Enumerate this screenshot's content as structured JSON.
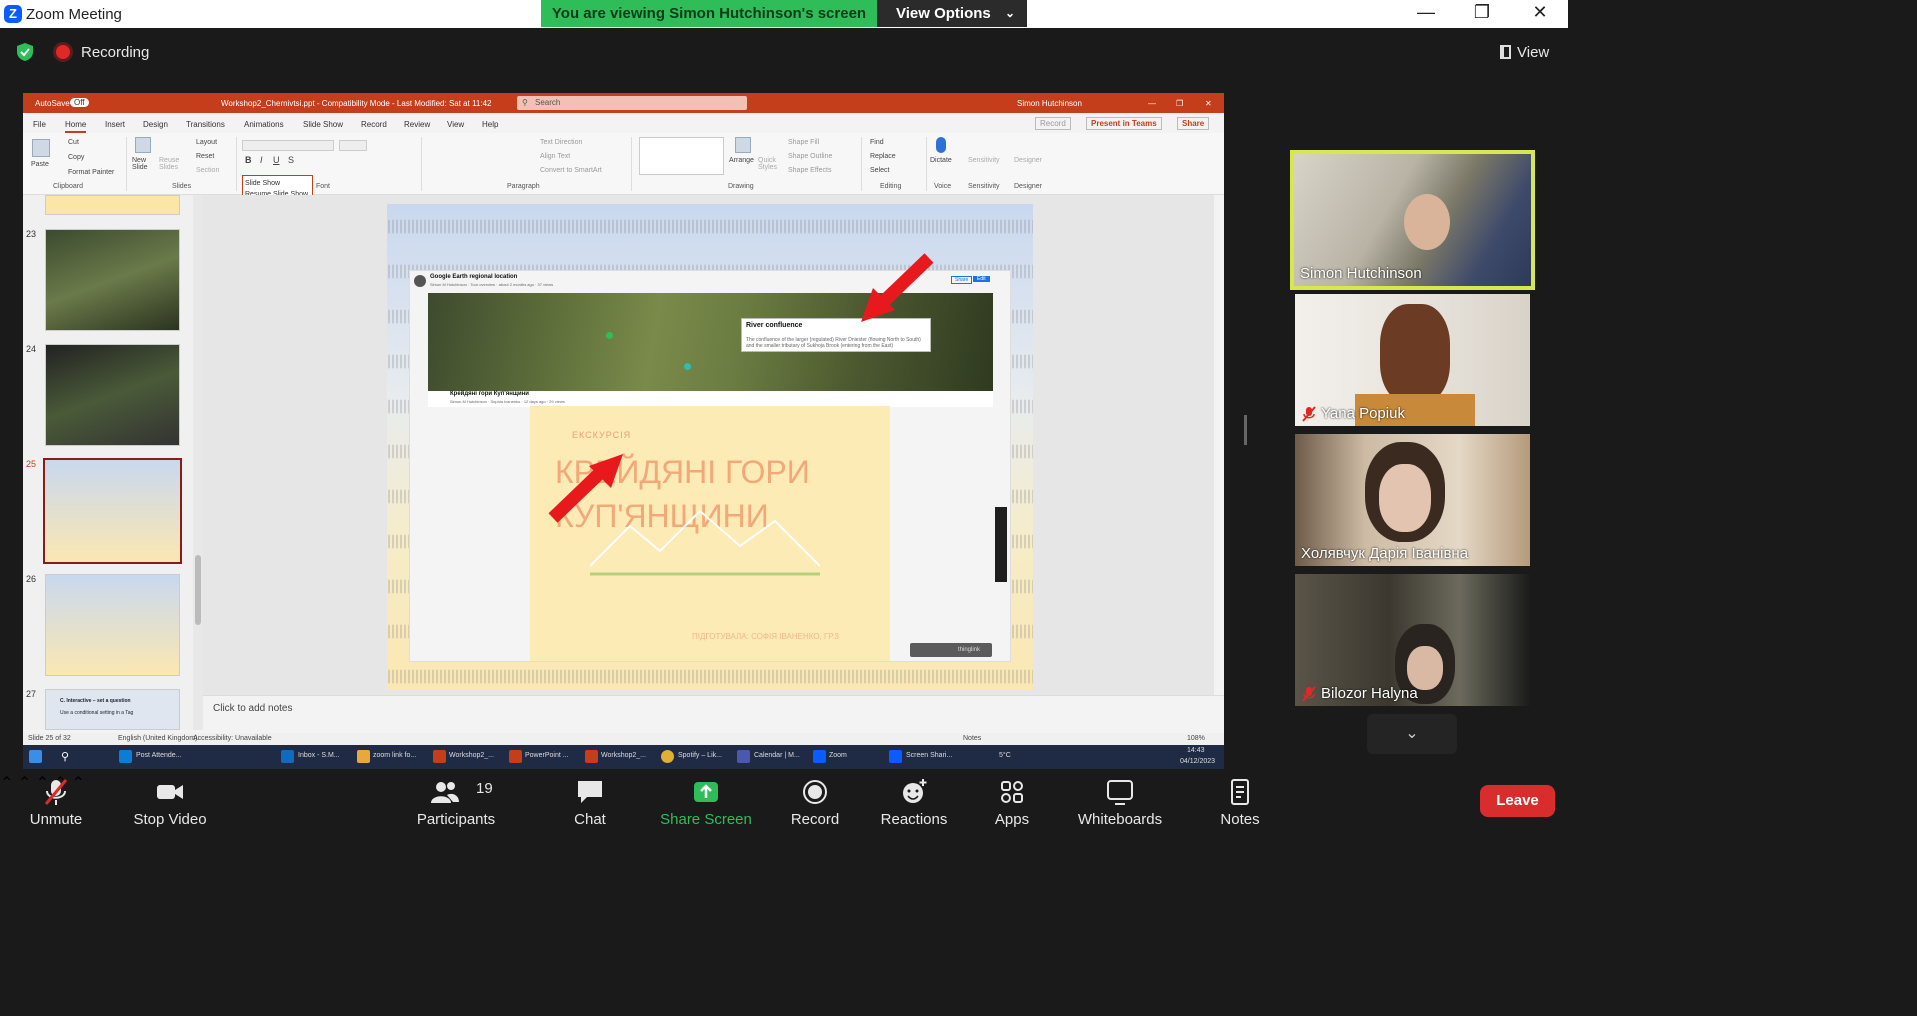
{
  "window": {
    "app_title": "Zoom Meeting",
    "viewing_banner": "You are viewing Simon Hutchinson's screen",
    "view_options_label": "View Options"
  },
  "topbar": {
    "recording_label": "Recording",
    "view_label": "View"
  },
  "powerpoint": {
    "autosave": "AutoSave",
    "autosave_state": "Off",
    "file_title": "Workshop2_Chernivtsi.ppt  -  Compatibility Mode  -  Last Modified: Sat at 11:42",
    "search_placeholder": "Search",
    "user_name": "Simon Hutchinson",
    "tabs": [
      "File",
      "Home",
      "Insert",
      "Design",
      "Transitions",
      "Animations",
      "Slide Show",
      "Record",
      "Review",
      "View",
      "Help"
    ],
    "right_buttons": {
      "record": "Record",
      "present_teams": "Present in Teams",
      "share": "Share"
    },
    "ribbon": {
      "clipboard": {
        "paste": "Paste",
        "cut": "Cut",
        "copy": "Copy",
        "format_painter": "Format Painter",
        "group": "Clipboard"
      },
      "slides": {
        "new_slide": "New Slide",
        "reuse": "Reuse Slides",
        "layout": "Layout",
        "reset": "Reset",
        "section": "Section",
        "group": "Slides"
      },
      "font_group": "Font",
      "paragraph": {
        "text_direction": "Text Direction",
        "align_text": "Align Text",
        "convert_smartart": "Convert to SmartArt",
        "group": "Paragraph"
      },
      "drawing": {
        "arrange": "Arrange",
        "quick_styles": "Quick Styles",
        "shape_fill": "Shape Fill",
        "shape_outline": "Shape Outline",
        "shape_effects": "Shape Effects",
        "group": "Drawing"
      },
      "editing": {
        "find": "Find",
        "replace": "Replace",
        "select": "Select",
        "group": "Editing"
      },
      "voice": {
        "dictate": "Dictate",
        "group": "Voice"
      },
      "sensitivity": {
        "label": "Sensitivity",
        "group": "Sensitivity"
      },
      "designer": {
        "label": "Designer",
        "group": "Designer"
      }
    },
    "slideshow_menu": [
      "Slide Show",
      "Resume Slide Show"
    ],
    "thumbnails": [
      {
        "num": "23",
        "selected": false
      },
      {
        "num": "24",
        "selected": false
      },
      {
        "num": "25",
        "selected": true
      },
      {
        "num": "26",
        "selected": false
      },
      {
        "num": "27",
        "selected": false,
        "caption": "C. Interactive – set a question",
        "sub": "Use a conditional setting in a Tag"
      }
    ],
    "slide": {
      "browser_title": "Google Earth regional location",
      "browser_author": "Simon M Hutchinson",
      "browser_meta": "Tour overview · about 2 months ago · 37 views",
      "share_label": "Share",
      "edit_label": "Edit",
      "info_title": "River confluence",
      "info_body": "The confluence of the larger (regulated) River Dniester (flowing North to South) and the smaller tributary of Sukhoja Brook (entering from the East)",
      "second_title": "Крейдяні гори Куп'янщини",
      "second_author": "Simon M Hutchinson",
      "second_meta": "Sophia Ivanenko · 12 days ago · 29 views",
      "ekskursia": "ЕКСКУРСІЯ",
      "poster_title_line1": "КРЕЙДЯНІ ГОРИ",
      "poster_title_line2": "КУП'ЯНЩИНИ",
      "poster_credit": "ПІДГОТУВАЛА: СОФІЯ ІВАНЕНКО, ГР.3",
      "thinglink": "thinglink"
    },
    "notes_placeholder": "Click to add notes",
    "status": {
      "slide_count": "Slide 25 of 32",
      "language": "English (United Kingdom)",
      "accessibility": "Accessibility: Unavailable",
      "notes_btn": "Notes",
      "zoom": "108%"
    }
  },
  "taskbar": {
    "items": [
      "Post Attende...",
      "Inbox - S.M...",
      "zoom link fo...",
      "Workshop2_...",
      "PowerPoint ...",
      "Workshop2_...",
      "Spotify – Lik...",
      "Calendar | M...",
      "Zoom",
      "Screen Shari..."
    ],
    "weather": "5°C",
    "time": "14:43",
    "date": "04/12/2023"
  },
  "participants": [
    {
      "name": "Simon Hutchinson",
      "muted": false,
      "active_speaker": true
    },
    {
      "name": "Yana Popiuk",
      "muted": true,
      "active_speaker": false
    },
    {
      "name": "Холявчук Дарія Іванівна",
      "muted": false,
      "active_speaker": false
    },
    {
      "name": "Bilozor Halyna",
      "muted": true,
      "active_speaker": false
    }
  ],
  "toolbar": {
    "unmute": "Unmute",
    "stop_video": "Stop Video",
    "participants": "Participants",
    "participant_count": "19",
    "chat": "Chat",
    "share_screen": "Share Screen",
    "record": "Record",
    "reactions": "Reactions",
    "apps": "Apps",
    "whiteboards": "Whiteboards",
    "notes": "Notes",
    "leave": "Leave"
  },
  "colors": {
    "zoom_green": "#2ebd59",
    "zoom_blue": "#0b5cff",
    "ppt_red": "#c43e1c",
    "leave_red": "#d92d2d",
    "active_speaker": "#d7e84a"
  }
}
